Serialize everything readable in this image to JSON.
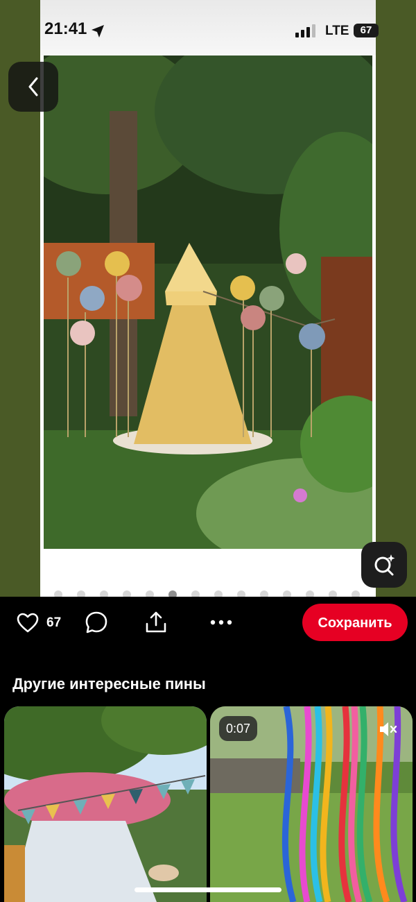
{
  "status": {
    "time": "21:41",
    "network": "LTE",
    "battery": "67"
  },
  "pin": {
    "image": "garden-tent-balloons-photo",
    "carousel_pages": 14,
    "active_page": 6
  },
  "actions": {
    "likes": "67",
    "save_label": "Сохранить"
  },
  "more_section": {
    "title": "Другие интересные пины"
  },
  "grid": [
    {
      "image": "garden-tent-bunting-photo"
    },
    {
      "image": "colorful-ribbons-video",
      "duration": "0:07"
    }
  ],
  "colors": {
    "save_button": "#e60023",
    "background": "#000000",
    "side_bg": "#4a5a26"
  }
}
